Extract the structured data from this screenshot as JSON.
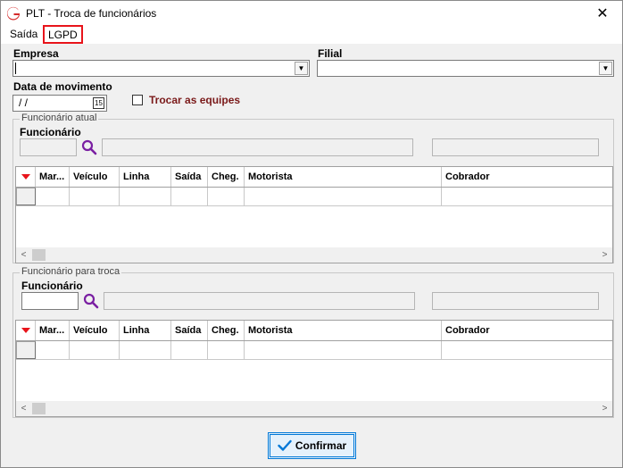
{
  "window": {
    "title": "PLT - Troca de funcionários",
    "close": "✕"
  },
  "menu": {
    "saida": "Saída",
    "lgpd": "LGPD"
  },
  "form": {
    "empresa_label": "Empresa",
    "filial_label": "Filial",
    "data_label": "Data de movimento",
    "data_value": " /  /",
    "cal_icon": "15",
    "trocar_label": "Trocar as equipes"
  },
  "group_atual": {
    "title": "Funcionário atual",
    "funcionario_label": "Funcionário"
  },
  "group_troca": {
    "title": "Funcionário para troca",
    "funcionario_label": "Funcionário"
  },
  "grid": {
    "columns": [
      "Mar...",
      "Veículo",
      "Linha",
      "Saída",
      "Cheg.",
      "Motorista",
      "Cobrador"
    ]
  },
  "buttons": {
    "confirm": "Confirmar"
  },
  "colors": {
    "accent": "#0078d7",
    "highlight": "#e8141b",
    "logo": "#d42a2a",
    "search": "#7a1fa2"
  },
  "icons": {
    "logo": "app-logo-icon",
    "search": "search-icon",
    "check": "check-icon",
    "dropdown": "chevron-down-icon",
    "calendar": "calendar-icon"
  }
}
